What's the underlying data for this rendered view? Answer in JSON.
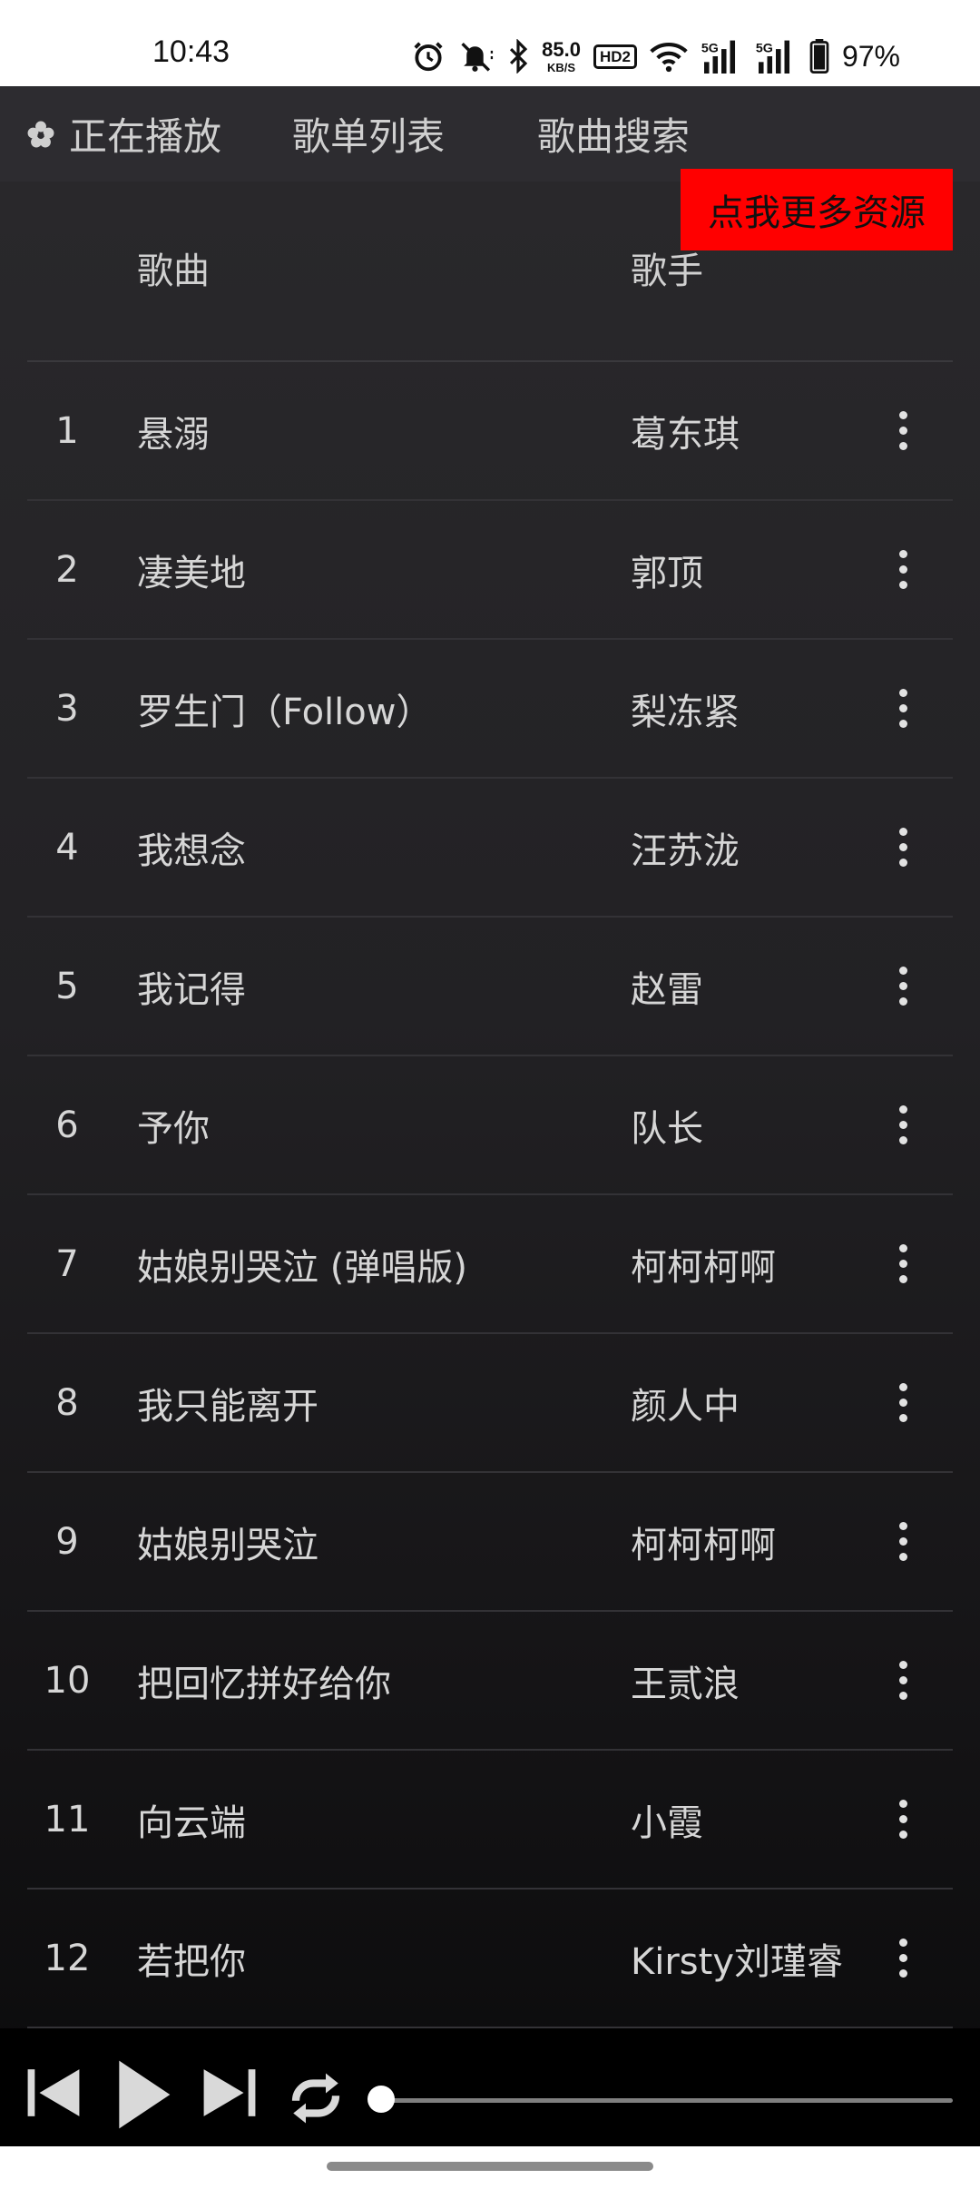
{
  "status_bar": {
    "time": "10:43",
    "net_speed": "85.0",
    "net_unit": "KB/S",
    "hd_label": "HD2",
    "signal1_label": "5G",
    "signal2_label": "5G",
    "battery": "97%",
    "icons": [
      "alarm-icon",
      "mute-icon",
      "bluetooth-icon",
      "hd-icon",
      "wifi-icon",
      "signal-icon",
      "signal-icon",
      "battery-icon"
    ]
  },
  "nav": {
    "now_playing": "正在播放",
    "playlist": "歌单列表",
    "search": "歌曲搜索"
  },
  "promo": {
    "label": "点我更多资源",
    "color": "#ff0000"
  },
  "table": {
    "col_song": "歌曲",
    "col_artist": "歌手",
    "rows": [
      {
        "num": "1",
        "title": "悬溺",
        "artist": "葛东琪"
      },
      {
        "num": "2",
        "title": "凄美地",
        "artist": "郭顶"
      },
      {
        "num": "3",
        "title": "罗生门（Follow）",
        "artist": "梨冻紧"
      },
      {
        "num": "4",
        "title": "我想念",
        "artist": "汪苏泷"
      },
      {
        "num": "5",
        "title": "我记得",
        "artist": "赵雷"
      },
      {
        "num": "6",
        "title": "予你",
        "artist": "队长"
      },
      {
        "num": "7",
        "title": "姑娘别哭泣 (弹唱版)",
        "artist": "柯柯柯啊"
      },
      {
        "num": "8",
        "title": "我只能离开",
        "artist": "颜人中"
      },
      {
        "num": "9",
        "title": "姑娘别哭泣",
        "artist": "柯柯柯啊"
      },
      {
        "num": "10",
        "title": "把回忆拼好给你",
        "artist": "王贰浪"
      },
      {
        "num": "11",
        "title": "向云端",
        "artist": "小霞"
      },
      {
        "num": "12",
        "title": "若把你",
        "artist": "Kirsty刘瑾睿"
      }
    ]
  },
  "player": {
    "progress": 0.0
  }
}
